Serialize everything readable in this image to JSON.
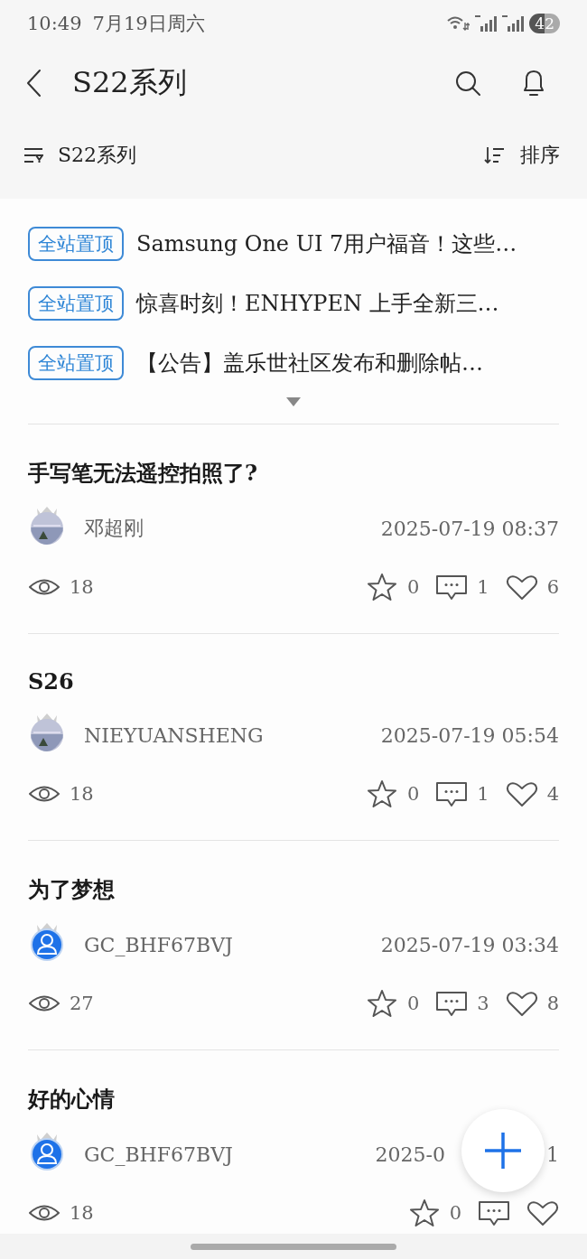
{
  "status_bar": {
    "time": "10:49",
    "date": "7月19日周六",
    "battery": "42"
  },
  "header": {
    "title": "S22系列"
  },
  "filter_bar": {
    "category": "S22系列",
    "sort": "排序"
  },
  "pinned": [
    {
      "tag": "全站置顶",
      "title": "Samsung One UI 7用户福音！这些…"
    },
    {
      "tag": "全站置顶",
      "title": "惊喜时刻！ENHYPEN 上手全新三…"
    },
    {
      "tag": "全站置顶",
      "title": "【公告】盖乐世社区发布和删除帖…"
    }
  ],
  "posts": [
    {
      "title": "手写笔无法遥控拍照了?",
      "author": "邓超刚",
      "date": "2025-07-19 08:37",
      "views": "18",
      "favorites": "0",
      "comments": "1",
      "likes": "6"
    },
    {
      "title": "S26",
      "author": "NIEYUANSHENG",
      "date": "2025-07-19 05:54",
      "views": "18",
      "favorites": "0",
      "comments": "1",
      "likes": "4"
    },
    {
      "title": "为了梦想",
      "author": "GC_BHF67BVJ",
      "avatar": {
        "kind": "default"
      },
      "date": "2025-07-19 03:34",
      "views": "27",
      "favorites": "0",
      "comments": "3",
      "likes": "8"
    },
    {
      "title": "好的心情",
      "author": "GC_BHF67BVJ",
      "avatar": {
        "kind": "default"
      },
      "date": "2025-0",
      "date_end": "1",
      "views": "18",
      "favorites": "0"
    }
  ]
}
